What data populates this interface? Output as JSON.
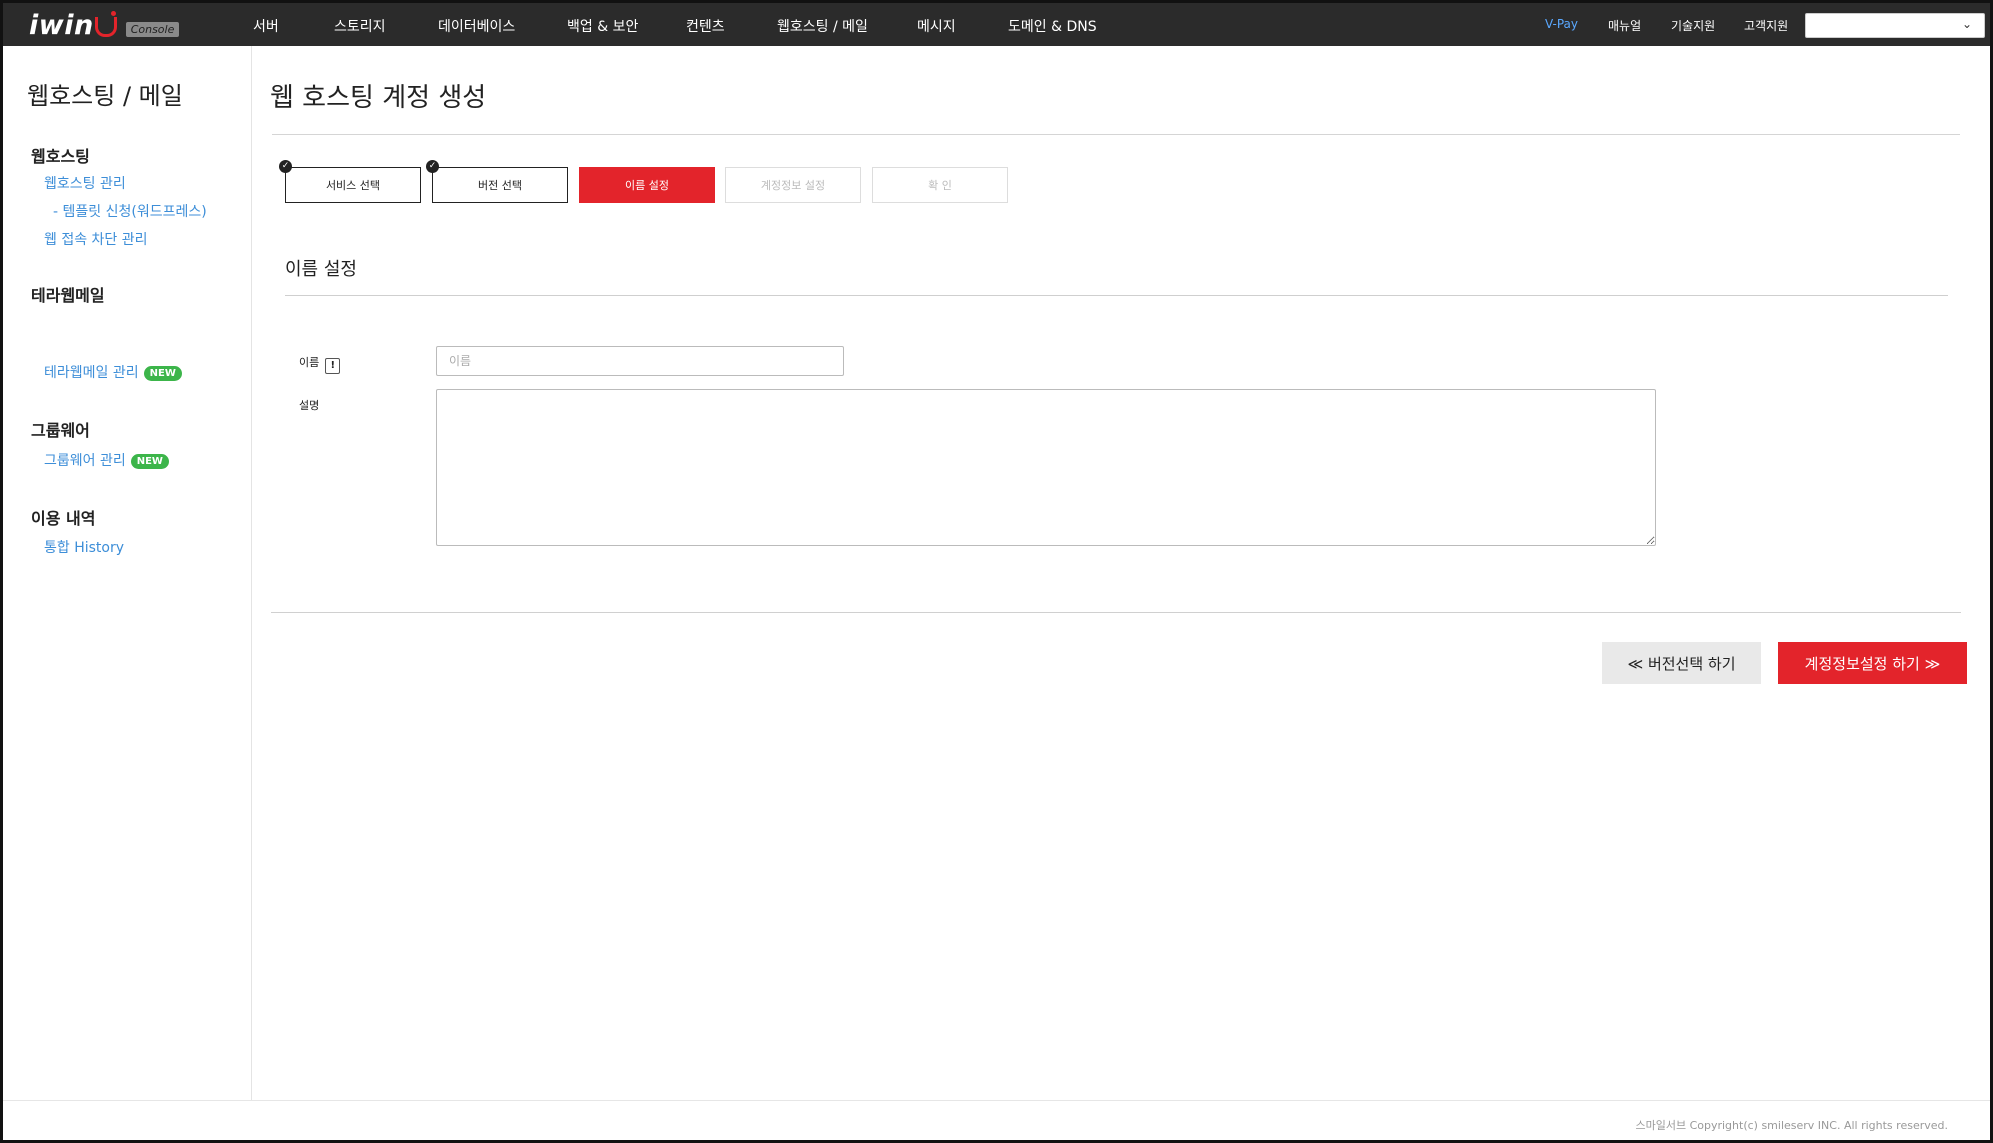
{
  "brand": {
    "logo_text": "iwin",
    "console_label": "Console"
  },
  "nav": {
    "items": [
      "서버",
      "스토리지",
      "데이터베이스",
      "백업 & 보안",
      "컨텐츠",
      "웹호스팅 / 메일",
      "메시지",
      "도메인 & DNS"
    ]
  },
  "utility": {
    "vpay": "V-Pay",
    "manual": "매뉴얼",
    "tech_support": "기술지원",
    "customer_support": "고객지원",
    "account_value": ""
  },
  "sidebar": {
    "title": "웹호스팅 / 메일",
    "sections": [
      {
        "heading": "웹호스팅",
        "links": [
          {
            "label": "웹호스팅 관리"
          },
          {
            "label": "- 템플릿 신청(워드프레스)"
          },
          {
            "label": "웹 접속 차단 관리"
          }
        ]
      },
      {
        "heading": "테라웹메일",
        "links": [
          {
            "label": "테라웹메일 관리",
            "badge": "NEW"
          }
        ]
      },
      {
        "heading": "그룹웨어",
        "links": [
          {
            "label": "그룹웨어 관리",
            "badge": "NEW"
          }
        ]
      },
      {
        "heading": "이용 내역",
        "links": [
          {
            "label": "통합 History"
          }
        ]
      }
    ]
  },
  "page": {
    "title": "웹 호스팅 계정 생성"
  },
  "steps": [
    {
      "label": "서비스 선택",
      "status": "done"
    },
    {
      "label": "버전 선택",
      "status": "done"
    },
    {
      "label": "이름 설정",
      "status": "active"
    },
    {
      "label": "계정정보 설정",
      "status": "pending"
    },
    {
      "label": "확  인",
      "status": "pending"
    }
  ],
  "form": {
    "section_title": "이름 설정",
    "name_label": "이름",
    "name_info_icon": "!",
    "name_placeholder": "이름",
    "name_value": "",
    "desc_label": "설명",
    "desc_value": ""
  },
  "actions": {
    "prev_label": "≪ 버전선택 하기",
    "next_label": "계정정보설정 하기 ≫"
  },
  "footer": {
    "copyright": "스마일서브 Copyright(c) smileserv INC. All rights reserved."
  },
  "colors": {
    "accent": "#e3242b",
    "link": "#3d8ed8",
    "badge": "#3cb54a",
    "topbar": "#2b2b2b"
  }
}
